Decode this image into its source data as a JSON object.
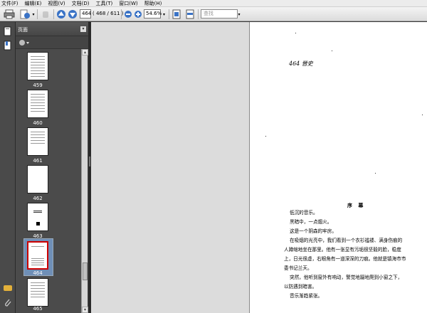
{
  "menu": [
    "文件(F)",
    "编辑(E)",
    "视图(V)",
    "文档(D)",
    "工具(T)",
    "窗口(W)",
    "帮助(H)"
  ],
  "toolbar": {
    "page_current": "464",
    "page_info": "( 468 / 611 )",
    "zoom": "54.6%",
    "search_placeholder": "查找"
  },
  "panel": {
    "title": "页面",
    "thumbnails": [
      {
        "label": "459",
        "selected": false
      },
      {
        "label": "460",
        "selected": false
      },
      {
        "label": "461",
        "selected": false
      },
      {
        "label": "462",
        "selected": false
      },
      {
        "label": "463",
        "selected": false
      },
      {
        "label": "464",
        "selected": true
      },
      {
        "label": "465",
        "selected": false
      }
    ]
  },
  "document": {
    "header": "464 晉史",
    "section_title": "序 幕",
    "lines": [
      "低沉的音乐。",
      "黑暗中，一点烟火。",
      "这是一个阴森的牢房。",
      "在吸烟的光亮中，我们看到一个衣衫褴褛、满身伤痕的",
      "人蹲缩地坐在那里。他有一张显有污垢很坚毅的脸，稳度",
      "上，日光很虚，右眼角有一道深深的刀痕。他就是镇海市市",
      "委书记兰天。",
      "突然，他听到窗外有响动，警觉地蹑地爬到小窗之下，",
      "以防遇到暗害。",
      "音乐渐趋紧张。"
    ]
  },
  "colors": {
    "selection": "#6f8fb7",
    "selected_border": "#cc0000",
    "panel_bg": "#4b4b4b"
  }
}
